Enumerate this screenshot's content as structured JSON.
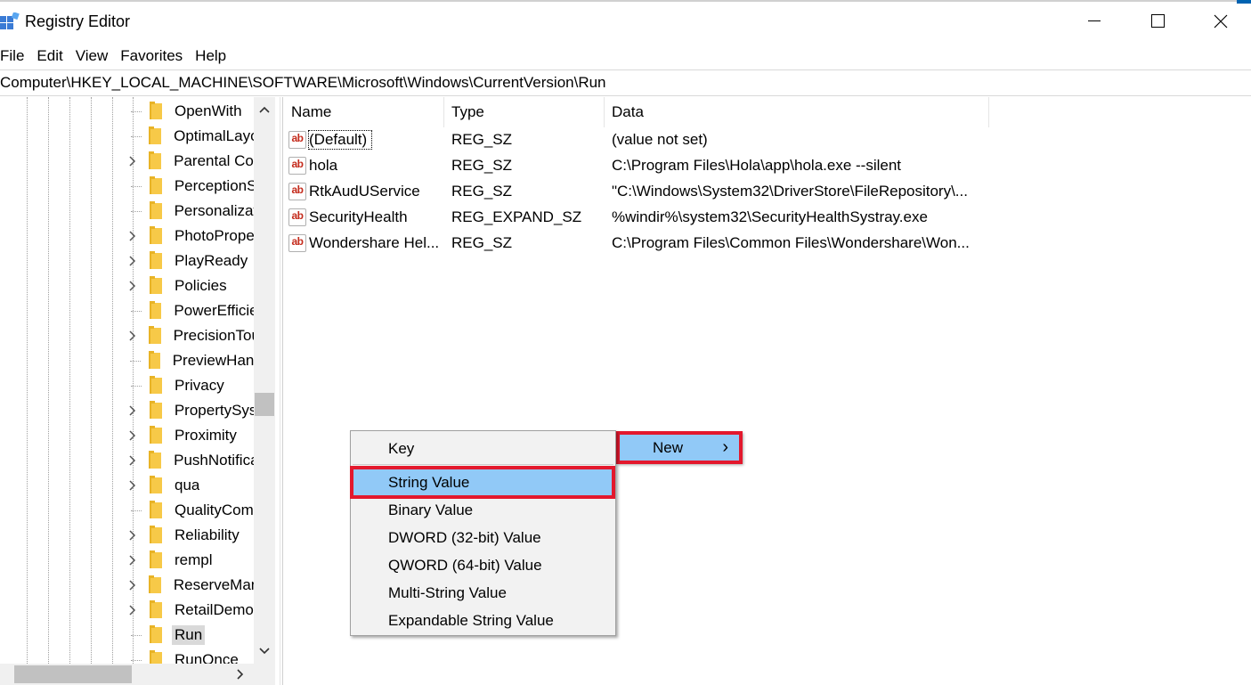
{
  "window": {
    "title": "Registry Editor",
    "controls": [
      "minimize",
      "maximize",
      "close"
    ]
  },
  "menubar": {
    "items": [
      "File",
      "Edit",
      "View",
      "Favorites",
      "Help"
    ]
  },
  "address": {
    "path": "Computer\\HKEY_LOCAL_MACHINE\\SOFTWARE\\Microsoft\\Windows\\CurrentVersion\\Run"
  },
  "tree": {
    "items": [
      {
        "label": "OpenWith",
        "expandable": false
      },
      {
        "label": "OptimalLayo",
        "expandable": false
      },
      {
        "label": "Parental Cor",
        "expandable": true
      },
      {
        "label": "PerceptionS",
        "expandable": false
      },
      {
        "label": "Personalizat",
        "expandable": false
      },
      {
        "label": "PhotoPrope",
        "expandable": true
      },
      {
        "label": "PlayReady",
        "expandable": true
      },
      {
        "label": "Policies",
        "expandable": true
      },
      {
        "label": "PowerEfficie",
        "expandable": false
      },
      {
        "label": "PrecisionTou",
        "expandable": true
      },
      {
        "label": "PreviewHand",
        "expandable": false
      },
      {
        "label": "Privacy",
        "expandable": false
      },
      {
        "label": "PropertySys",
        "expandable": true
      },
      {
        "label": "Proximity",
        "expandable": true
      },
      {
        "label": "PushNotifica",
        "expandable": true
      },
      {
        "label": "qua",
        "expandable": true
      },
      {
        "label": "QualityCom",
        "expandable": false
      },
      {
        "label": "Reliability",
        "expandable": true
      },
      {
        "label": "rempl",
        "expandable": true
      },
      {
        "label": "ReserveMan",
        "expandable": true
      },
      {
        "label": "RetailDemo",
        "expandable": true
      },
      {
        "label": "Run",
        "expandable": false,
        "selected": true
      },
      {
        "label": "RunOnce",
        "expandable": false
      }
    ]
  },
  "list": {
    "columns": [
      "Name",
      "Type",
      "Data"
    ],
    "rows": [
      {
        "name": "(Default)",
        "type": "REG_SZ",
        "data": "(value not set)"
      },
      {
        "name": "hola",
        "type": "REG_SZ",
        "data": "C:\\Program Files\\Hola\\app\\hola.exe --silent"
      },
      {
        "name": "RtkAudUService",
        "type": "REG_SZ",
        "data": "\"C:\\Windows\\System32\\DriverStore\\FileRepository\\..."
      },
      {
        "name": "SecurityHealth",
        "type": "REG_EXPAND_SZ",
        "data": "%windir%\\system32\\SecurityHealthSystray.exe"
      },
      {
        "name": "Wondershare Hel...",
        "type": "REG_SZ",
        "data": "C:\\Program Files\\Common Files\\Wondershare\\Won..."
      }
    ],
    "icon_text": "ab"
  },
  "context_menu": {
    "new_label": "New",
    "new_arrow": "›"
  },
  "submenu": {
    "items": [
      "Key",
      "String Value",
      "Binary Value",
      "DWORD (32-bit) Value",
      "QWORD (64-bit) Value",
      "Multi-String Value",
      "Expandable String Value"
    ],
    "highlighted": "String Value"
  },
  "colors": {
    "highlight": "#91c9f7",
    "annotation_red": "#e3182d",
    "menu_bg": "#f2f2f2"
  }
}
